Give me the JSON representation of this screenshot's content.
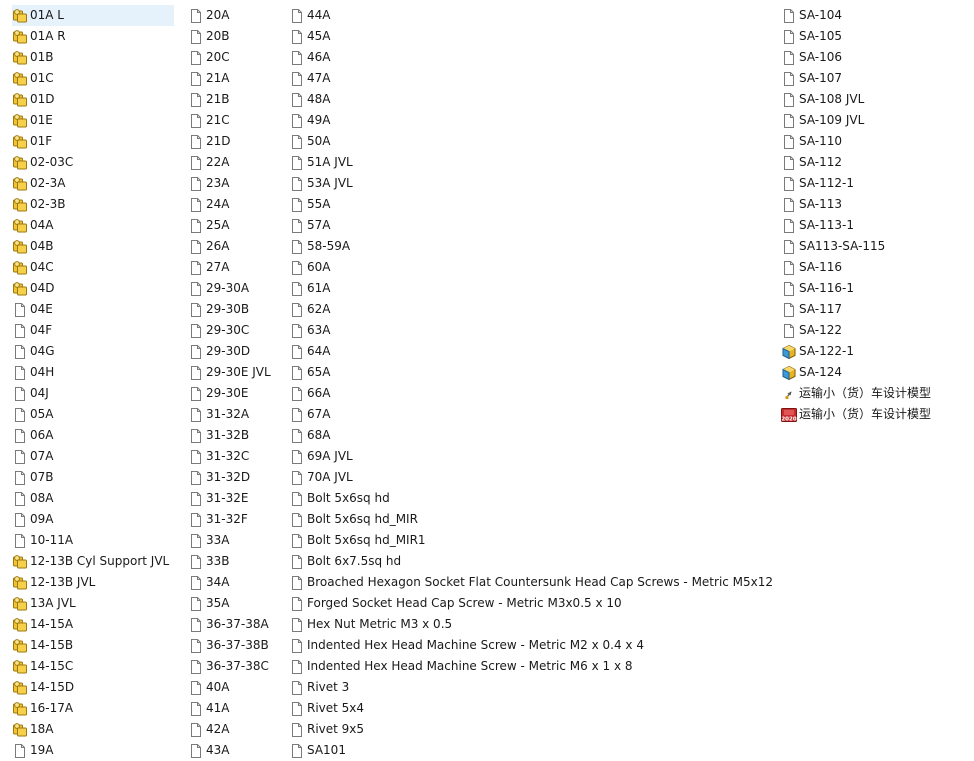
{
  "window": {
    "view": "list"
  },
  "columns": [
    {
      "id": "c1",
      "items": [
        {
          "label": "01A L",
          "icon": "assembly-icon",
          "selected": true
        },
        {
          "label": "01A R",
          "icon": "assembly-icon"
        },
        {
          "label": "01B",
          "icon": "assembly-icon"
        },
        {
          "label": "01C",
          "icon": "assembly-icon"
        },
        {
          "label": "01D",
          "icon": "assembly-icon"
        },
        {
          "label": "01E",
          "icon": "assembly-icon"
        },
        {
          "label": "01F",
          "icon": "assembly-icon"
        },
        {
          "label": "02-03C",
          "icon": "assembly-icon"
        },
        {
          "label": "02-3A",
          "icon": "assembly-icon"
        },
        {
          "label": "02-3B",
          "icon": "assembly-icon"
        },
        {
          "label": "04A",
          "icon": "assembly-icon"
        },
        {
          "label": "04B",
          "icon": "assembly-icon"
        },
        {
          "label": "04C",
          "icon": "assembly-icon"
        },
        {
          "label": "04D",
          "icon": "assembly-icon"
        },
        {
          "label": "04E",
          "icon": "file-icon"
        },
        {
          "label": "04F",
          "icon": "file-icon"
        },
        {
          "label": "04G",
          "icon": "file-icon"
        },
        {
          "label": "04H",
          "icon": "file-icon"
        },
        {
          "label": "04J",
          "icon": "file-icon"
        },
        {
          "label": "05A",
          "icon": "file-icon"
        },
        {
          "label": "06A",
          "icon": "file-icon"
        },
        {
          "label": "07A",
          "icon": "file-icon"
        },
        {
          "label": "07B",
          "icon": "file-icon"
        },
        {
          "label": "08A",
          "icon": "file-icon"
        },
        {
          "label": "09A",
          "icon": "file-icon"
        },
        {
          "label": "10-11A",
          "icon": "file-icon"
        },
        {
          "label": "12-13B Cyl Support JVL",
          "icon": "assembly-icon"
        },
        {
          "label": "12-13B JVL",
          "icon": "assembly-icon"
        },
        {
          "label": "13A JVL",
          "icon": "assembly-icon"
        },
        {
          "label": "14-15A",
          "icon": "assembly-icon"
        },
        {
          "label": "14-15B",
          "icon": "assembly-icon"
        },
        {
          "label": "14-15C",
          "icon": "assembly-icon"
        },
        {
          "label": "14-15D",
          "icon": "assembly-icon"
        },
        {
          "label": "16-17A",
          "icon": "assembly-icon"
        },
        {
          "label": "18A",
          "icon": "assembly-icon"
        },
        {
          "label": "19A",
          "icon": "file-icon"
        }
      ]
    },
    {
      "id": "c2",
      "items": [
        {
          "label": "20A",
          "icon": "file-icon"
        },
        {
          "label": "20B",
          "icon": "file-icon"
        },
        {
          "label": "20C",
          "icon": "file-icon"
        },
        {
          "label": "21A",
          "icon": "file-icon"
        },
        {
          "label": "21B",
          "icon": "file-icon"
        },
        {
          "label": "21C",
          "icon": "file-icon"
        },
        {
          "label": "21D",
          "icon": "file-icon"
        },
        {
          "label": "22A",
          "icon": "file-icon"
        },
        {
          "label": "23A",
          "icon": "file-icon"
        },
        {
          "label": "24A",
          "icon": "file-icon"
        },
        {
          "label": "25A",
          "icon": "file-icon"
        },
        {
          "label": "26A",
          "icon": "file-icon"
        },
        {
          "label": "27A",
          "icon": "file-icon"
        },
        {
          "label": "29-30A",
          "icon": "file-icon"
        },
        {
          "label": "29-30B",
          "icon": "file-icon"
        },
        {
          "label": "29-30C",
          "icon": "file-icon"
        },
        {
          "label": "29-30D",
          "icon": "file-icon"
        },
        {
          "label": "29-30E JVL",
          "icon": "file-icon"
        },
        {
          "label": "29-30E",
          "icon": "file-icon"
        },
        {
          "label": "31-32A",
          "icon": "file-icon"
        },
        {
          "label": "31-32B",
          "icon": "file-icon"
        },
        {
          "label": "31-32C",
          "icon": "file-icon"
        },
        {
          "label": "31-32D",
          "icon": "file-icon"
        },
        {
          "label": "31-32E",
          "icon": "file-icon"
        },
        {
          "label": "31-32F",
          "icon": "file-icon"
        },
        {
          "label": "33A",
          "icon": "file-icon"
        },
        {
          "label": "33B",
          "icon": "file-icon"
        },
        {
          "label": "34A",
          "icon": "file-icon"
        },
        {
          "label": "35A",
          "icon": "file-icon"
        },
        {
          "label": "36-37-38A",
          "icon": "file-icon"
        },
        {
          "label": "36-37-38B",
          "icon": "file-icon"
        },
        {
          "label": "36-37-38C",
          "icon": "file-icon"
        },
        {
          "label": "40A",
          "icon": "file-icon"
        },
        {
          "label": "41A",
          "icon": "file-icon"
        },
        {
          "label": "42A",
          "icon": "file-icon"
        },
        {
          "label": "43A",
          "icon": "file-icon"
        }
      ]
    },
    {
      "id": "c3",
      "items": [
        {
          "label": "44A",
          "icon": "file-icon"
        },
        {
          "label": "45A",
          "icon": "file-icon"
        },
        {
          "label": "46A",
          "icon": "file-icon"
        },
        {
          "label": "47A",
          "icon": "file-icon"
        },
        {
          "label": "48A",
          "icon": "file-icon"
        },
        {
          "label": "49A",
          "icon": "file-icon"
        },
        {
          "label": "50A",
          "icon": "file-icon"
        },
        {
          "label": "51A JVL",
          "icon": "file-icon"
        },
        {
          "label": "53A JVL",
          "icon": "file-icon"
        },
        {
          "label": "55A",
          "icon": "file-icon"
        },
        {
          "label": "57A",
          "icon": "file-icon"
        },
        {
          "label": "58-59A",
          "icon": "file-icon"
        },
        {
          "label": "60A",
          "icon": "file-icon"
        },
        {
          "label": "61A",
          "icon": "file-icon"
        },
        {
          "label": "62A",
          "icon": "file-icon"
        },
        {
          "label": "63A",
          "icon": "file-icon"
        },
        {
          "label": "64A",
          "icon": "file-icon"
        },
        {
          "label": "65A",
          "icon": "file-icon"
        },
        {
          "label": "66A",
          "icon": "file-icon"
        },
        {
          "label": "67A",
          "icon": "file-icon"
        },
        {
          "label": "68A",
          "icon": "file-icon"
        },
        {
          "label": "69A JVL",
          "icon": "file-icon"
        },
        {
          "label": "70A JVL",
          "icon": "file-icon"
        },
        {
          "label": "Bolt 5x6sq hd",
          "icon": "file-icon"
        },
        {
          "label": "Bolt 5x6sq hd_MIR",
          "icon": "file-icon"
        },
        {
          "label": "Bolt 5x6sq hd_MIR1",
          "icon": "file-icon"
        },
        {
          "label": "Bolt 6x7.5sq hd",
          "icon": "file-icon"
        },
        {
          "label": "Broached Hexagon Socket Flat Countersunk Head Cap Screws - Metric M5x12",
          "icon": "file-icon"
        },
        {
          "label": "Forged Socket Head Cap Screw - Metric M3x0.5 x 10",
          "icon": "file-icon"
        },
        {
          "label": "Hex Nut Metric M3 x 0.5",
          "icon": "file-icon"
        },
        {
          "label": "Indented Hex Head Machine Screw - Metric M2 x 0.4 x 4",
          "icon": "file-icon"
        },
        {
          "label": "Indented Hex Head Machine Screw - Metric M6 x 1 x 8",
          "icon": "file-icon"
        },
        {
          "label": "Rivet 3",
          "icon": "file-icon"
        },
        {
          "label": "Rivet 5x4",
          "icon": "file-icon"
        },
        {
          "label": "Rivet 9x5",
          "icon": "file-icon"
        },
        {
          "label": "SA101",
          "icon": "file-icon"
        }
      ]
    },
    {
      "id": "c4",
      "items": [
        {
          "label": "SA-104",
          "icon": "file-icon"
        },
        {
          "label": "SA-105",
          "icon": "file-icon"
        },
        {
          "label": "SA-106",
          "icon": "file-icon"
        },
        {
          "label": "SA-107",
          "icon": "file-icon"
        },
        {
          "label": "SA-108 JVL",
          "icon": "file-icon"
        },
        {
          "label": "SA-109 JVL",
          "icon": "file-icon"
        },
        {
          "label": "SA-110",
          "icon": "file-icon"
        },
        {
          "label": "SA-112",
          "icon": "file-icon"
        },
        {
          "label": "SA-112-1",
          "icon": "file-icon"
        },
        {
          "label": "SA-113",
          "icon": "file-icon"
        },
        {
          "label": "SA-113-1",
          "icon": "file-icon"
        },
        {
          "label": "SA113-SA-115",
          "icon": "file-icon"
        },
        {
          "label": "SA-116",
          "icon": "file-icon"
        },
        {
          "label": "SA-116-1",
          "icon": "file-icon"
        },
        {
          "label": "SA-117",
          "icon": "file-icon"
        },
        {
          "label": "SA-122",
          "icon": "file-icon"
        },
        {
          "label": "SA-122-1",
          "icon": "part-icon"
        },
        {
          "label": "SA-124",
          "icon": "part-icon"
        },
        {
          "label": "运输小（货）车设计模型",
          "icon": "shortcut-icon"
        },
        {
          "label": "运输小（货）车设计模型",
          "icon": "app-2020-icon"
        }
      ]
    }
  ]
}
